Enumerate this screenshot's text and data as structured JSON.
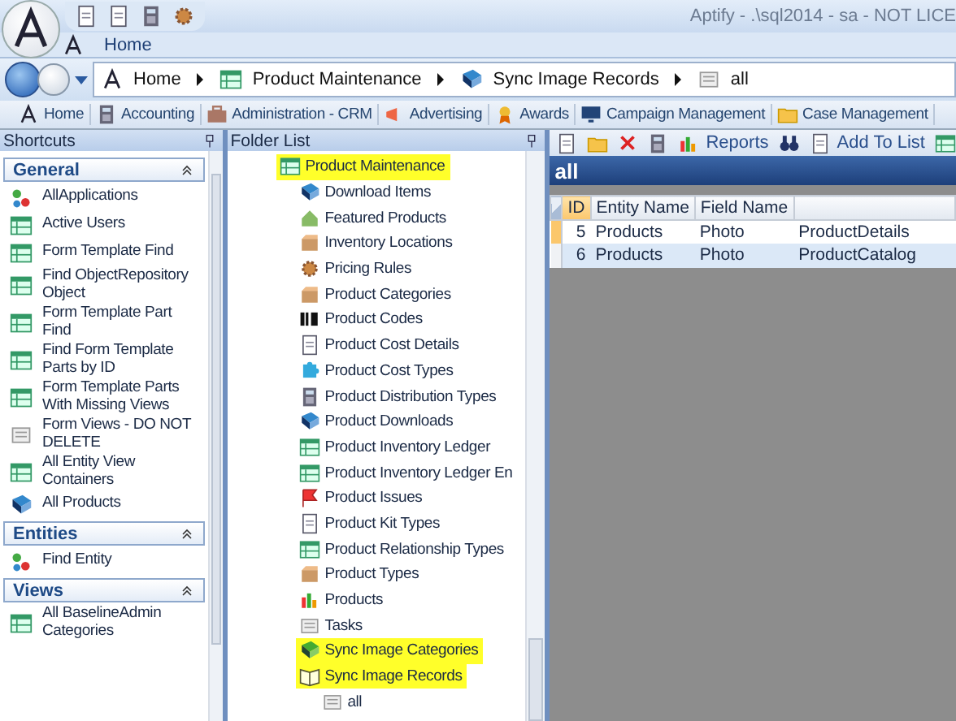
{
  "window": {
    "title": "Aptify - .\\sql2014 - sa - NOT LICE"
  },
  "ribbon_tabs": [
    {
      "label": "Home",
      "selected": true
    }
  ],
  "breadcrumb": [
    "Home",
    "Product Maintenance",
    "Sync Image Records",
    "all"
  ],
  "app_toolbar": [
    "Home",
    "Accounting",
    "Administration - CRM",
    "Advertising",
    "Awards",
    "Campaign Management",
    "Case Management"
  ],
  "shortcuts": {
    "title": "Shortcuts",
    "sections": [
      {
        "title": "General",
        "expanded": true,
        "items": [
          "AllApplications",
          "Active Users",
          "Form Template Find",
          "Find ObjectRepository Object",
          "Form Template Part Find",
          "Find Form Template Parts by ID",
          "Form Template Parts With Missing Views",
          "Form Views - DO NOT DELETE",
          "All Entity View Containers",
          "All Products"
        ]
      },
      {
        "title": "Entities",
        "expanded": true,
        "items": [
          "Find Entity"
        ]
      },
      {
        "title": "Views",
        "expanded": true,
        "items": [
          "All BaselineAdmin Categories"
        ]
      }
    ]
  },
  "folder_list": {
    "title": "Folder List",
    "tree": [
      {
        "label": "Product Maintenance",
        "highlighted": true,
        "children": [
          {
            "label": "Download Items",
            "highlighted": false
          },
          {
            "label": "Featured Products",
            "highlighted": false
          },
          {
            "label": "Inventory Locations",
            "highlighted": false
          },
          {
            "label": "Pricing Rules",
            "highlighted": false
          },
          {
            "label": "Product Categories",
            "highlighted": false
          },
          {
            "label": "Product Codes",
            "highlighted": false
          },
          {
            "label": "Product Cost Details",
            "highlighted": false
          },
          {
            "label": "Product Cost Types",
            "highlighted": false
          },
          {
            "label": "Product Distribution Types",
            "highlighted": false
          },
          {
            "label": "Product Downloads",
            "highlighted": false
          },
          {
            "label": "Product Inventory Ledger",
            "highlighted": false
          },
          {
            "label": "Product Inventory Ledger En",
            "highlighted": false
          },
          {
            "label": "Product Issues",
            "highlighted": false
          },
          {
            "label": "Product Kit Types",
            "highlighted": false
          },
          {
            "label": "Product Relationship Types",
            "highlighted": false
          },
          {
            "label": "Product Types",
            "highlighted": false
          },
          {
            "label": "Products",
            "highlighted": false
          },
          {
            "label": "Tasks",
            "highlighted": false
          },
          {
            "label": "Sync Image Categories",
            "highlighted": true
          },
          {
            "label": "Sync Image Records",
            "highlighted": true,
            "children": [
              {
                "label": "all",
                "highlighted": false
              }
            ]
          }
        ]
      }
    ]
  },
  "view": {
    "toolbar": [
      "Reports",
      "Add To List"
    ],
    "title": "all",
    "columns": [
      "ID",
      "Entity Name",
      "Field Name"
    ],
    "rows": [
      {
        "cells": [
          "5",
          "Products",
          "Photo",
          "ProductDetails"
        ],
        "current": true,
        "selected": false
      },
      {
        "cells": [
          "6",
          "Products",
          "Photo",
          "ProductCatalog"
        ],
        "current": false,
        "selected": true
      }
    ]
  }
}
